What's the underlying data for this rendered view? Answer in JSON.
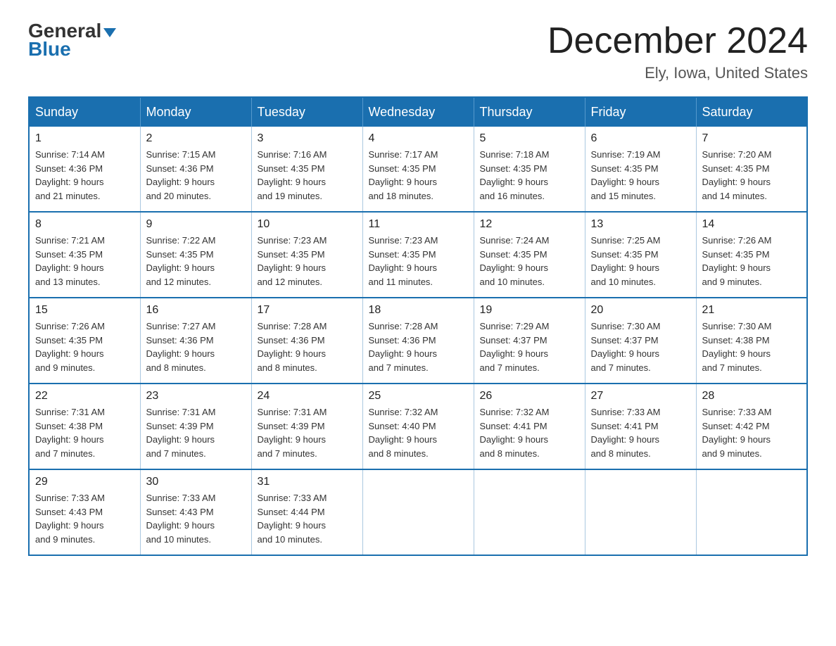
{
  "logo": {
    "general": "General",
    "arrow": "▲",
    "blue": "Blue"
  },
  "header": {
    "month": "December 2024",
    "location": "Ely, Iowa, United States"
  },
  "weekdays": [
    "Sunday",
    "Monday",
    "Tuesday",
    "Wednesday",
    "Thursday",
    "Friday",
    "Saturday"
  ],
  "weeks": [
    [
      {
        "day": "1",
        "sunrise": "7:14 AM",
        "sunset": "4:36 PM",
        "daylight": "9 hours and 21 minutes."
      },
      {
        "day": "2",
        "sunrise": "7:15 AM",
        "sunset": "4:36 PM",
        "daylight": "9 hours and 20 minutes."
      },
      {
        "day": "3",
        "sunrise": "7:16 AM",
        "sunset": "4:35 PM",
        "daylight": "9 hours and 19 minutes."
      },
      {
        "day": "4",
        "sunrise": "7:17 AM",
        "sunset": "4:35 PM",
        "daylight": "9 hours and 18 minutes."
      },
      {
        "day": "5",
        "sunrise": "7:18 AM",
        "sunset": "4:35 PM",
        "daylight": "9 hours and 16 minutes."
      },
      {
        "day": "6",
        "sunrise": "7:19 AM",
        "sunset": "4:35 PM",
        "daylight": "9 hours and 15 minutes."
      },
      {
        "day": "7",
        "sunrise": "7:20 AM",
        "sunset": "4:35 PM",
        "daylight": "9 hours and 14 minutes."
      }
    ],
    [
      {
        "day": "8",
        "sunrise": "7:21 AM",
        "sunset": "4:35 PM",
        "daylight": "9 hours and 13 minutes."
      },
      {
        "day": "9",
        "sunrise": "7:22 AM",
        "sunset": "4:35 PM",
        "daylight": "9 hours and 12 minutes."
      },
      {
        "day": "10",
        "sunrise": "7:23 AM",
        "sunset": "4:35 PM",
        "daylight": "9 hours and 12 minutes."
      },
      {
        "day": "11",
        "sunrise": "7:23 AM",
        "sunset": "4:35 PM",
        "daylight": "9 hours and 11 minutes."
      },
      {
        "day": "12",
        "sunrise": "7:24 AM",
        "sunset": "4:35 PM",
        "daylight": "9 hours and 10 minutes."
      },
      {
        "day": "13",
        "sunrise": "7:25 AM",
        "sunset": "4:35 PM",
        "daylight": "9 hours and 10 minutes."
      },
      {
        "day": "14",
        "sunrise": "7:26 AM",
        "sunset": "4:35 PM",
        "daylight": "9 hours and 9 minutes."
      }
    ],
    [
      {
        "day": "15",
        "sunrise": "7:26 AM",
        "sunset": "4:35 PM",
        "daylight": "9 hours and 9 minutes."
      },
      {
        "day": "16",
        "sunrise": "7:27 AM",
        "sunset": "4:36 PM",
        "daylight": "9 hours and 8 minutes."
      },
      {
        "day": "17",
        "sunrise": "7:28 AM",
        "sunset": "4:36 PM",
        "daylight": "9 hours and 8 minutes."
      },
      {
        "day": "18",
        "sunrise": "7:28 AM",
        "sunset": "4:36 PM",
        "daylight": "9 hours and 7 minutes."
      },
      {
        "day": "19",
        "sunrise": "7:29 AM",
        "sunset": "4:37 PM",
        "daylight": "9 hours and 7 minutes."
      },
      {
        "day": "20",
        "sunrise": "7:30 AM",
        "sunset": "4:37 PM",
        "daylight": "9 hours and 7 minutes."
      },
      {
        "day": "21",
        "sunrise": "7:30 AM",
        "sunset": "4:38 PM",
        "daylight": "9 hours and 7 minutes."
      }
    ],
    [
      {
        "day": "22",
        "sunrise": "7:31 AM",
        "sunset": "4:38 PM",
        "daylight": "9 hours and 7 minutes."
      },
      {
        "day": "23",
        "sunrise": "7:31 AM",
        "sunset": "4:39 PM",
        "daylight": "9 hours and 7 minutes."
      },
      {
        "day": "24",
        "sunrise": "7:31 AM",
        "sunset": "4:39 PM",
        "daylight": "9 hours and 7 minutes."
      },
      {
        "day": "25",
        "sunrise": "7:32 AM",
        "sunset": "4:40 PM",
        "daylight": "9 hours and 8 minutes."
      },
      {
        "day": "26",
        "sunrise": "7:32 AM",
        "sunset": "4:41 PM",
        "daylight": "9 hours and 8 minutes."
      },
      {
        "day": "27",
        "sunrise": "7:33 AM",
        "sunset": "4:41 PM",
        "daylight": "9 hours and 8 minutes."
      },
      {
        "day": "28",
        "sunrise": "7:33 AM",
        "sunset": "4:42 PM",
        "daylight": "9 hours and 9 minutes."
      }
    ],
    [
      {
        "day": "29",
        "sunrise": "7:33 AM",
        "sunset": "4:43 PM",
        "daylight": "9 hours and 9 minutes."
      },
      {
        "day": "30",
        "sunrise": "7:33 AM",
        "sunset": "4:43 PM",
        "daylight": "9 hours and 10 minutes."
      },
      {
        "day": "31",
        "sunrise": "7:33 AM",
        "sunset": "4:44 PM",
        "daylight": "9 hours and 10 minutes."
      },
      null,
      null,
      null,
      null
    ]
  ],
  "labels": {
    "sunrise": "Sunrise: ",
    "sunset": "Sunset: ",
    "daylight": "Daylight: "
  }
}
